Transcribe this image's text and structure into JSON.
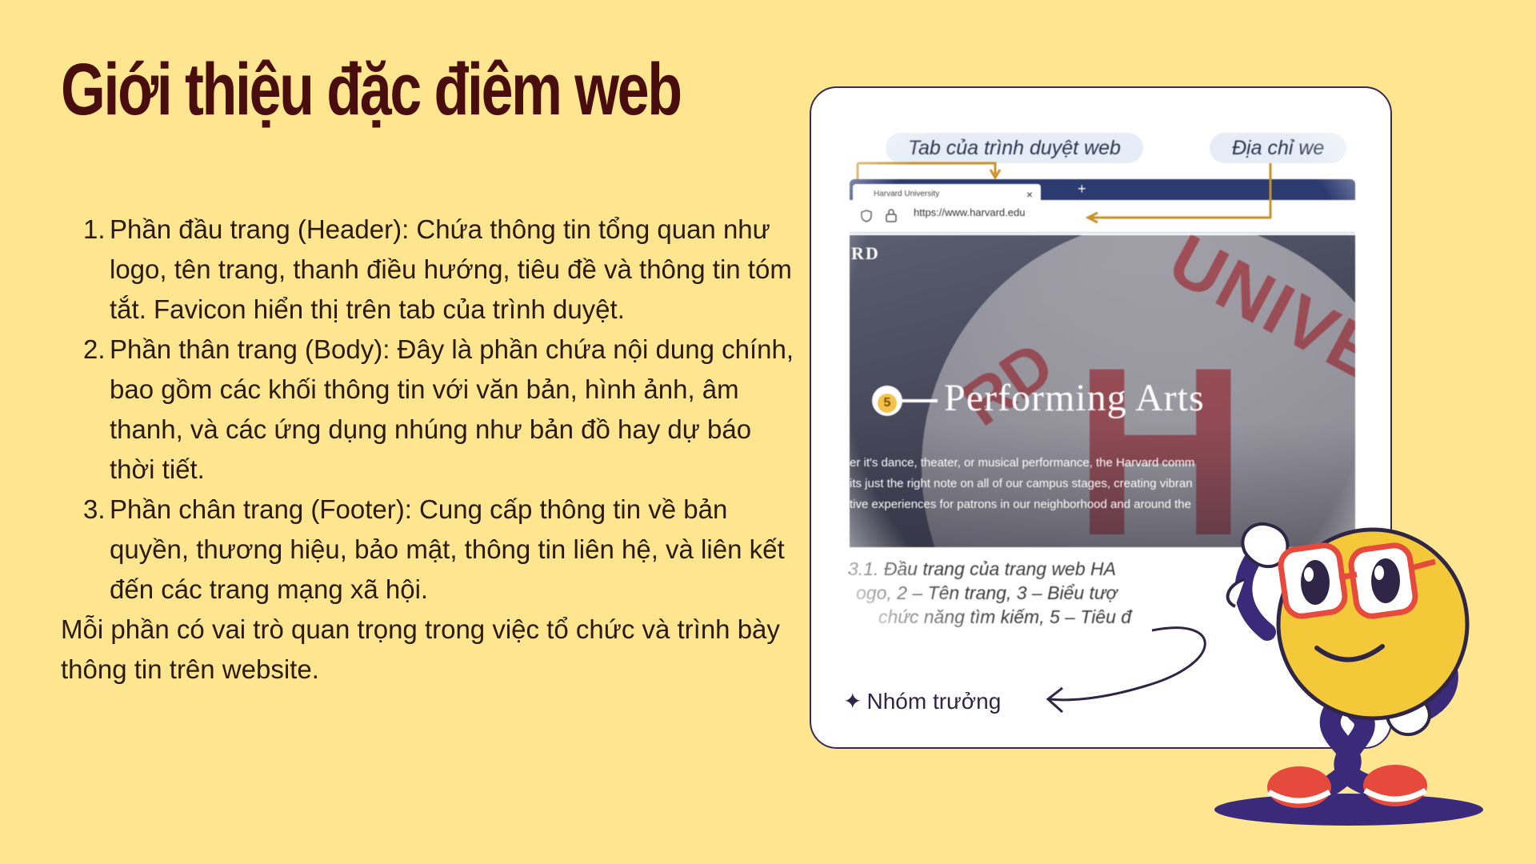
{
  "slide": {
    "title": "Giới thiệu đặc điêm web",
    "list": [
      {
        "number": "1.",
        "text": "Phần đầu trang (Header): Chứa thông tin tổng quan như logo, tên trang, thanh điều hướng, tiêu đề và thông tin tóm tắt. Favicon hiển thị trên tab của trình duyệt."
      },
      {
        "number": "2.",
        "text": "Phần thân trang (Body): Đây là phần chứa nội dung chính, bao gồm các khối thông tin với văn bản, hình ảnh, âm thanh, và các ứng dụng nhúng như bản đồ hay dự báo thời tiết."
      },
      {
        "number": "3.",
        "text": "Phần chân trang (Footer): Cung cấp thông tin về bản quyền, thương hiệu, bảo mật, thông tin liên hệ, và liên kết đến các trang mạng xã hội."
      }
    ],
    "summary": "Mỗi phần có vai trò quan trọng trong việc tổ chức và trình bày thông tin trên website."
  },
  "card": {
    "screenshot": {
      "label_tab": "Tab của trình duyệt web",
      "label_address": "Địa chỉ we",
      "browser_tab_title": "Harvard University",
      "tab_close": "×",
      "tab_plus": "+",
      "address_url": "https://www.harvard.edu",
      "hero_logo_fragment": "RD",
      "hero_badge": "5",
      "hero_title": "Performing Arts",
      "hero_desc_lines": [
        "er it's dance, theater, or musical performance, the Harvard comm",
        "its just the right note on all of our campus stages, creating vibran",
        "tive experiences for patrons in our neighborhood and around the"
      ],
      "caption_lines": [
        "3.1. Đầu trang của trang web HA",
        "ogo, 2 – Tên trang, 3 – Biểu tượ",
        "chức năng tìm kiếm, 5 – Tiêu đ"
      ]
    },
    "leader_label": "Nhóm trưởng"
  },
  "icons": {
    "star": "sparkle-icon",
    "mascot": "smiley-mascot-illustration"
  },
  "colors": {
    "background": "#fde68f",
    "title": "#4a0d0d",
    "text": "#2b1a10",
    "card_border": "#3a2a55",
    "accent_red": "#c94a4f",
    "mascot_yellow": "#f3c93a",
    "mascot_purple": "#3b2a7a"
  }
}
